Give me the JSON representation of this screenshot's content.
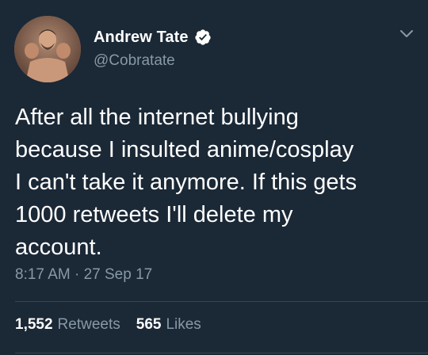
{
  "author": {
    "display_name": "Andrew Tate",
    "handle": "@Cobratate",
    "verified": true
  },
  "icons": {
    "verified": "verified-badge-icon",
    "menu": "chevron-down-icon"
  },
  "tweet": {
    "lines": [
      "After all the internet bullying",
      "because I insulted anime/cosplay",
      "I can't take it anymore. If this gets",
      "1000 retweets I'll delete my",
      "account."
    ],
    "timestamp": "8:17 AM · 27 Sep 17"
  },
  "stats": {
    "retweets_count": "1,552",
    "retweets_label": "Retweets",
    "likes_count": "565",
    "likes_label": "Likes"
  },
  "colors": {
    "background": "#1b2836",
    "primary_text": "#ffffff",
    "secondary_text": "#8899a6",
    "divider": "#38444d"
  }
}
